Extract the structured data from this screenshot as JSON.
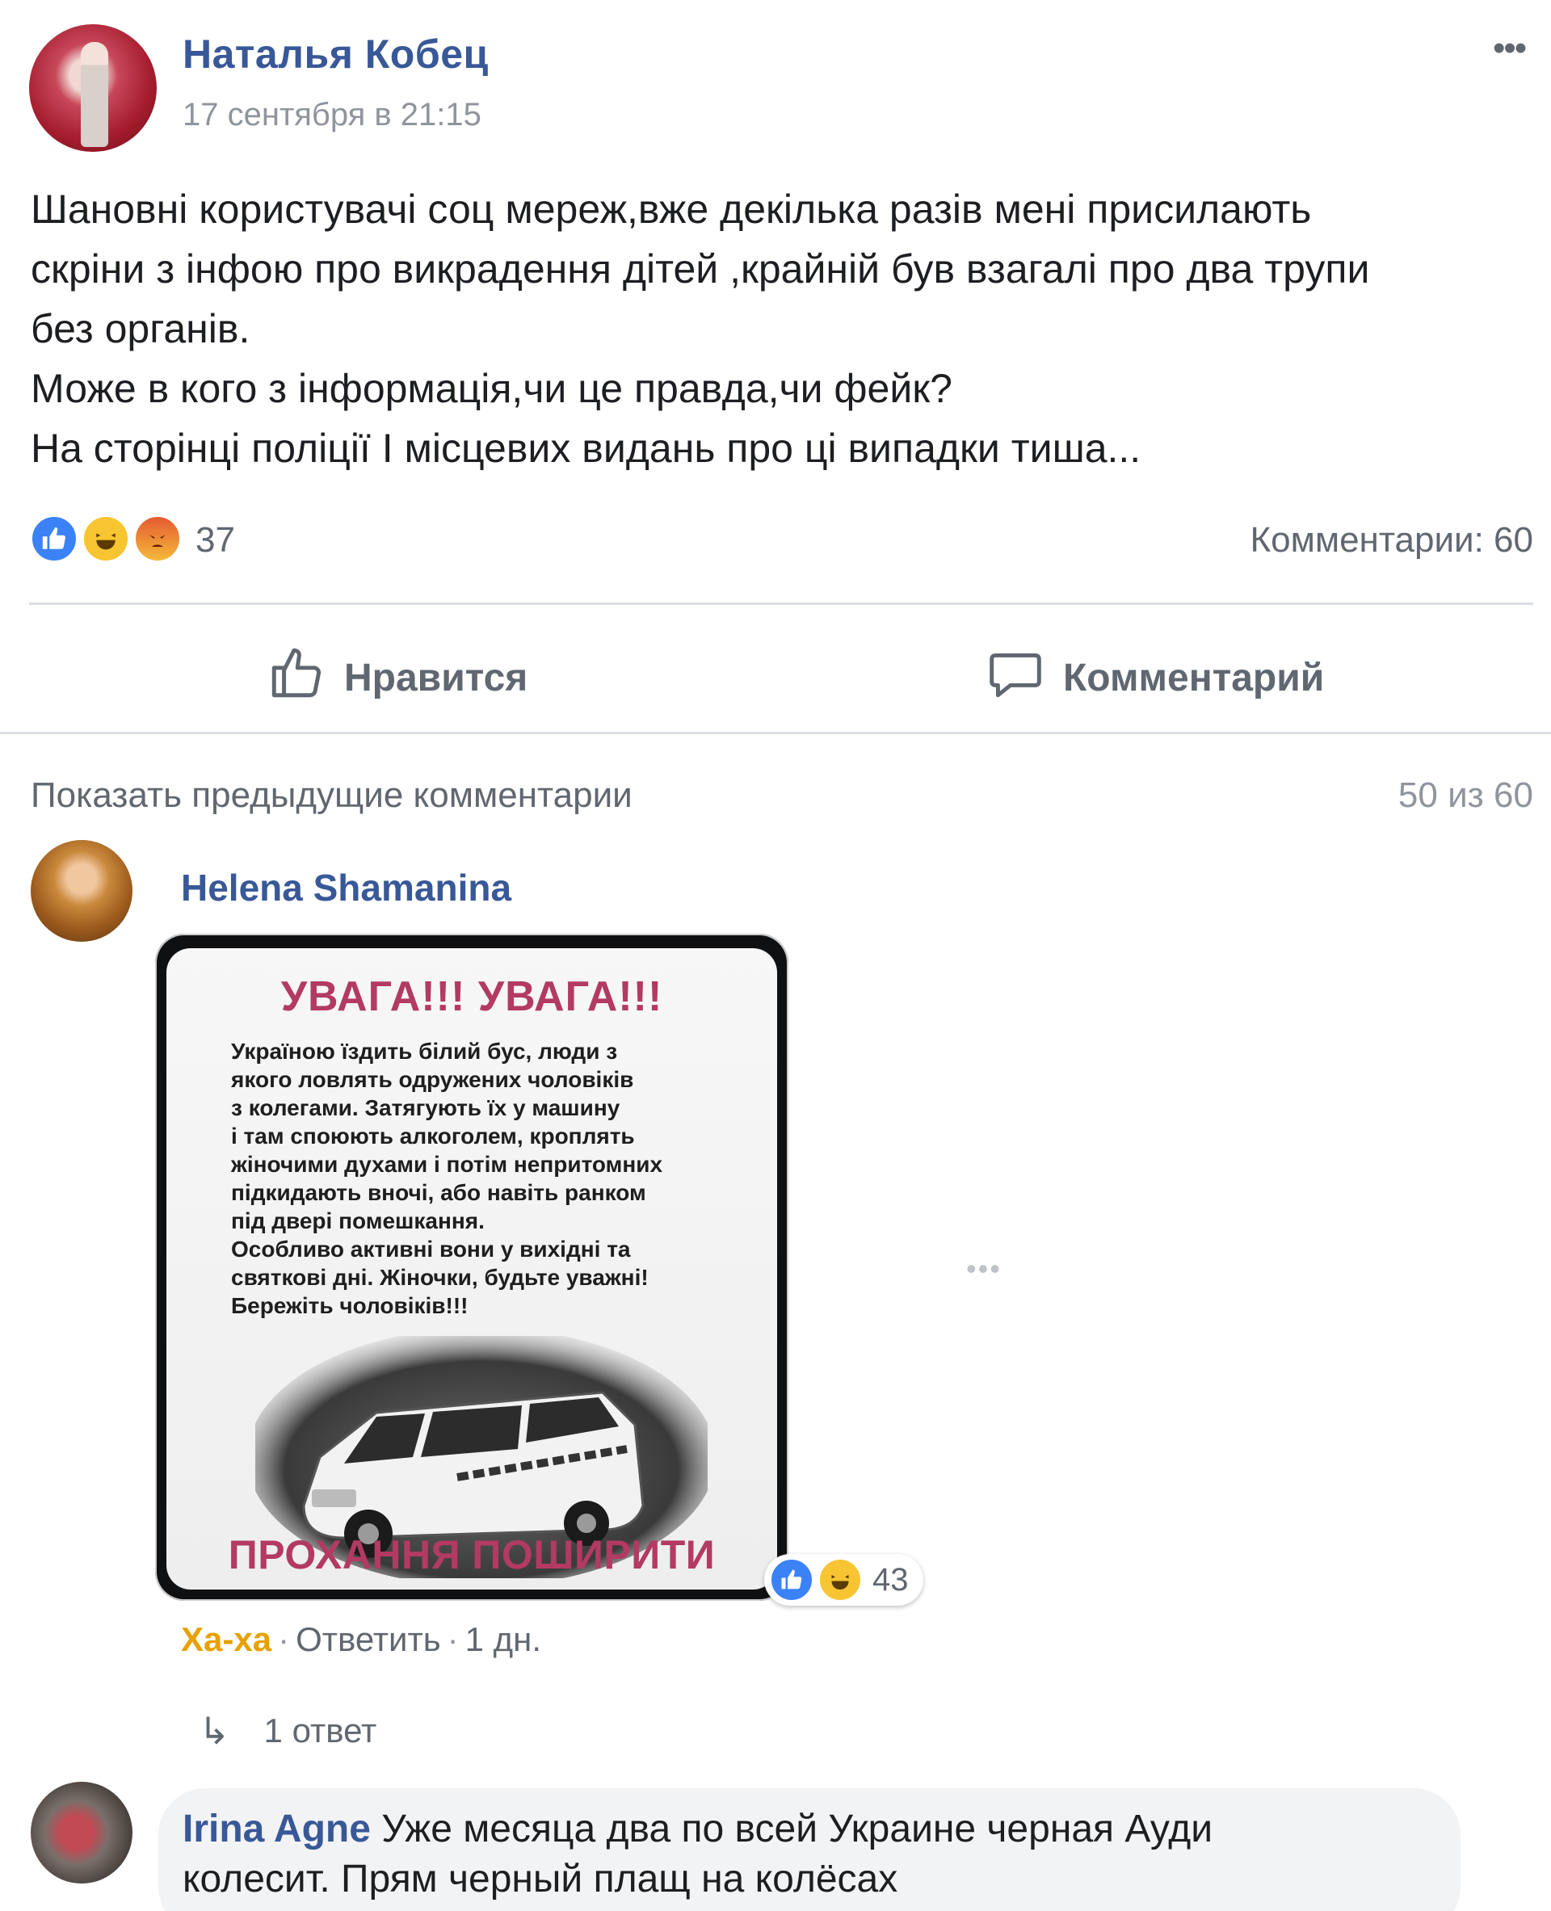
{
  "post": {
    "author": "Наталья Кобец",
    "time": "17 сентября в 21:15",
    "menu_icon": "more-icon",
    "body_lines": [
      "Шановні користувачі соц мереж,вже декілька разів мені присилають",
      "скріни з інфою про викрадення дітей ,крайній був взагалі про два трупи",
      "без органів.",
      "Може в кого з інформація,чи це правда,чи фейк?",
      "На сторінці поліції І місцевих видань про ці випадки тиша..."
    ],
    "reactions": {
      "icons": [
        "like-icon",
        "haha-icon",
        "angry-icon"
      ],
      "count": "37"
    },
    "comments_count": "Комментарии: 60"
  },
  "actions": {
    "like_label": "Нравится",
    "comment_label": "Комментарий"
  },
  "comments_header": {
    "show_previous": "Показать предыдущие комментарии",
    "pager": "50 из 60"
  },
  "comments": [
    {
      "author": "Helena Shamanina",
      "image": {
        "title": "УВАГА!!! УВАГА!!!",
        "body_lines": [
          "Україною їздить білий бус, люди з",
          "якого ловлять одружених чоловіків",
          "з колегами. Затягують їх у машину",
          "і там споюють алкоголем, кроплять",
          "жіночими духами і потім непритомних",
          "підкидають вночі, або навіть ранком",
          "під двері помешкання.",
          "Особливо активні вони у вихідні та",
          "святкові дні. Жіночки, будьте уважні!",
          "Бережіть чоловіків!!!"
        ],
        "footer": "ПРОХАННЯ ПОШИРИТИ"
      },
      "reactions": {
        "icons": [
          "like-icon",
          "haha-icon"
        ],
        "count": "43"
      },
      "meta": {
        "reaction_label": "Ха-ха",
        "reply_label": "Ответить",
        "age": "1 дн."
      },
      "replies_label": "1 ответ"
    },
    {
      "author": "Irina Agne",
      "text_line1": "Уже месяца два по всей Украине черная Ауди",
      "text_line2": "колесит. Прям черный плащ на колёсах"
    }
  ],
  "colors": {
    "link_blue": "#385898",
    "secondary_text": "#606770",
    "divider": "#dadde1",
    "bubble": "#f2f3f5",
    "haha_orange": "#e7a100",
    "image_pink": "#b23a63"
  }
}
